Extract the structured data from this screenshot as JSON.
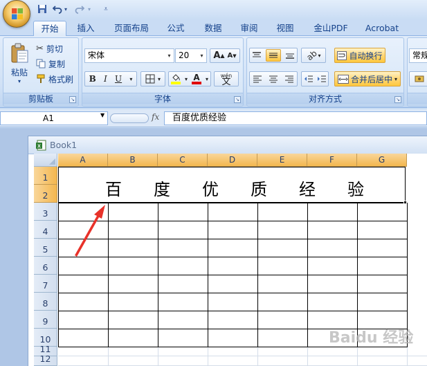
{
  "quick_access": {
    "save_icon": "save-icon",
    "undo_icon": "undo-icon",
    "redo_icon": "redo-icon",
    "customize_icon": "customize-arrow-icon"
  },
  "tabs": [
    {
      "label": "开始",
      "active": true
    },
    {
      "label": "插入"
    },
    {
      "label": "页面布局"
    },
    {
      "label": "公式"
    },
    {
      "label": "数据"
    },
    {
      "label": "审阅"
    },
    {
      "label": "视图"
    },
    {
      "label": "金山PDF"
    },
    {
      "label": "Acrobat"
    }
  ],
  "clipboard": {
    "paste": "粘贴",
    "cut": "剪切",
    "copy": "复制",
    "format_painter": "格式刷",
    "group_label": "剪贴板"
  },
  "font": {
    "name": "宋体",
    "size": "20",
    "bold": "B",
    "italic": "I",
    "underline": "U",
    "grow": "A",
    "shrink": "A",
    "font_color_letter": "A",
    "phonetic": "wén",
    "group_label": "字体"
  },
  "alignment": {
    "wrap_text": "自动换行",
    "merge_center": "合并后居中",
    "group_label": "对齐方式"
  },
  "number": {
    "format": "常规"
  },
  "formula_bar": {
    "name_box": "A1",
    "fx": "fx",
    "content": "百度优质经验"
  },
  "workbook": {
    "title": "Book1"
  },
  "columns": [
    "A",
    "B",
    "C",
    "D",
    "E",
    "F",
    "G"
  ],
  "rows": [
    "1",
    "2",
    "3",
    "4",
    "5",
    "6",
    "7",
    "8",
    "9",
    "10",
    "11",
    "12"
  ],
  "merged_cell": {
    "chars": [
      "百",
      "度",
      "优",
      "质",
      "经",
      "验"
    ]
  },
  "colors": {
    "selected_header": "#f3b74f",
    "annotation_arrow": "#e8322a",
    "ribbon_highlight": "#ffc83e"
  },
  "watermark": "Baidu 经验"
}
